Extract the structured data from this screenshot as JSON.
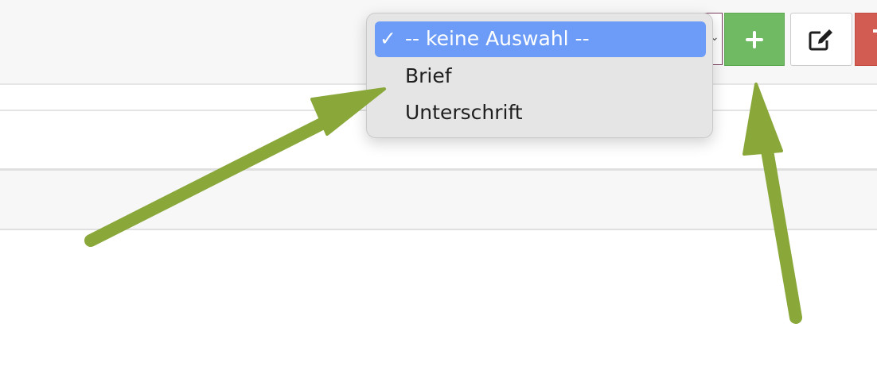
{
  "dropdown": {
    "options": [
      {
        "label": "-- keine Auswahl --",
        "selected": true,
        "check": "✓"
      },
      {
        "label": "Brief",
        "selected": false
      },
      {
        "label": "Unterschrift",
        "selected": false
      }
    ],
    "highlight_color": "#6c9cf7"
  },
  "toolbar": {
    "add_icon": "plus-icon",
    "edit_icon": "edit-icon",
    "delete_icon": "trash-icon",
    "add_color": "#6fba62",
    "delete_color": "#d25c52"
  },
  "annotations": {
    "arrow_color": "#8aa83a"
  }
}
